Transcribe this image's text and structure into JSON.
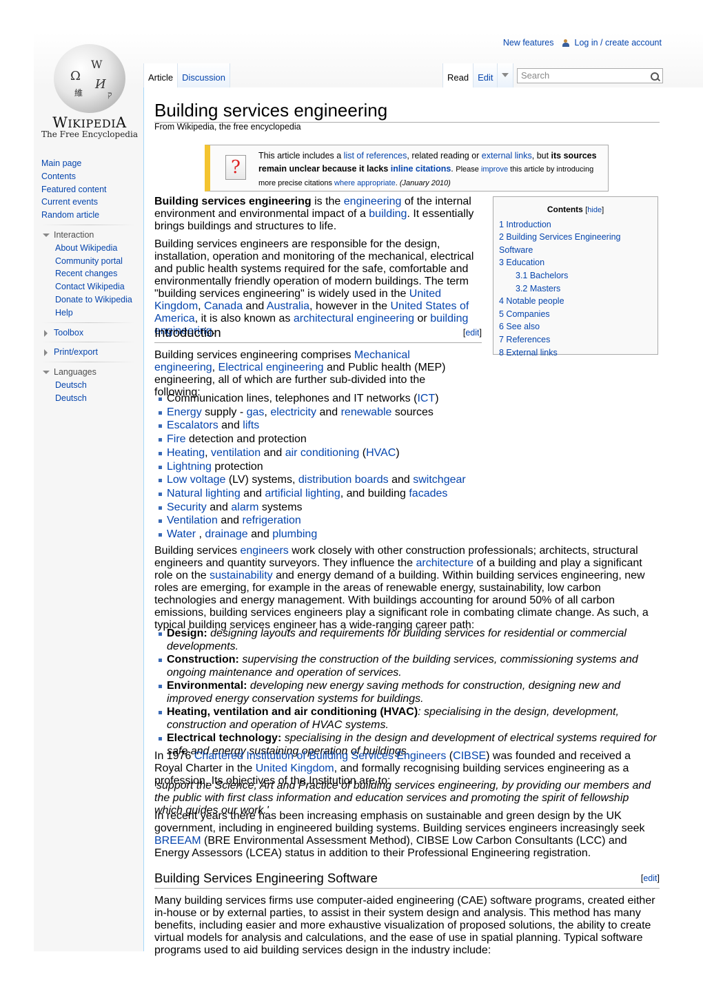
{
  "personal": {
    "new_features": "New features",
    "login": "Log in / create account"
  },
  "logo": {
    "wordmark_main": "Wikipedia",
    "tagline": "The Free Encyclopedia"
  },
  "tabs": {
    "article": "Article",
    "discussion": "Discussion",
    "read": "Read",
    "edit": "Edit"
  },
  "search": {
    "placeholder": "Search"
  },
  "sidebar": {
    "nav": [
      "Main page",
      "Contents",
      "Featured content",
      "Current events",
      "Random article"
    ],
    "interaction": {
      "title": "Interaction",
      "items": [
        "About Wikipedia",
        "Community portal",
        "Recent changes",
        "Contact Wikipedia",
        "Donate to Wikipedia",
        "Help"
      ]
    },
    "toolbox": "Toolbox",
    "print_export": "Print/export",
    "languages": {
      "title": "Languages",
      "items": [
        "Deutsch",
        "Deutsch"
      ]
    }
  },
  "article": {
    "title": "Building services engineering",
    "subtitle": "From Wikipedia, the free encyclopedia",
    "ambox": {
      "t1": "This article includes a ",
      "l1": "list of references",
      "t2": ", related reading or ",
      "l2": "external links",
      "t3": ", but ",
      "b1": "its sources remain unclear because it lacks ",
      "l3": "inline citations",
      "t4": ". ",
      "t5": "Please ",
      "l4": "improve",
      "t6": " this article by introducing more precise citations ",
      "l5": "where appropriate",
      "t7": ". ",
      "date": "(January 2010)"
    },
    "toc": {
      "title": "Contents",
      "hide": "hide",
      "items": [
        {
          "label": "1 Introduction",
          "sub": false
        },
        {
          "label": "2 Building Services Engineering Software",
          "sub": false
        },
        {
          "label": "3 Education",
          "sub": false
        },
        {
          "label": "3.1 Bachelors",
          "sub": true
        },
        {
          "label": "3.2 Masters",
          "sub": true
        },
        {
          "label": "4 Notable people",
          "sub": false
        },
        {
          "label": "5 Companies",
          "sub": false
        },
        {
          "label": "6 See also",
          "sub": false
        },
        {
          "label": "7 References",
          "sub": false
        },
        {
          "label": "8 External links",
          "sub": false
        }
      ]
    },
    "lead1": {
      "b": "Building services engineering",
      "t1": " is the ",
      "l1": "engineering",
      "t2": " of the internal environment and environmental impact of a ",
      "l2": "building",
      "t3": ". It essentially brings buildings and structures to life."
    },
    "lead2": {
      "t1": "Building services engineers are responsible for the design, installation, operation and monitoring of the mechanical, electrical and public health systems required for the safe, comfortable and environmentally friendly operation of modern buildings. The term \"building services engineering\" is widely used in the ",
      "l1": "United Kingdom",
      "t2": ", ",
      "l2": "Canada",
      "t3": " and ",
      "l3": "Australia",
      "t4": ", however in the ",
      "l4": "United States of America",
      "t5": ", it is also known as ",
      "l5": "architectural engineering",
      "t6": " or ",
      "l6": "building engineering",
      "t7": "."
    },
    "intro_heading": "Introduction",
    "edit_label": "edit",
    "intro_p": {
      "t1": "Building services engineering comprises ",
      "l1": "Mechanical engineering",
      "t2": ", ",
      "l2": "Electrical engineering",
      "t3": " and Public health (MEP) engineering, all of which are further sub-divided into the following:"
    },
    "systems_list": [
      [
        {
          "t": "Communication lines, telephones and IT networks ("
        },
        {
          "l": "ICT"
        },
        {
          "t": ")"
        }
      ],
      [
        {
          "l": "Energy"
        },
        {
          "t": " supply - "
        },
        {
          "l": "gas"
        },
        {
          "t": ", "
        },
        {
          "l": "electricity"
        },
        {
          "t": " and "
        },
        {
          "l": "renewable"
        },
        {
          "t": " sources"
        }
      ],
      [
        {
          "l": "Escalators"
        },
        {
          "t": " and "
        },
        {
          "l": "lifts"
        }
      ],
      [
        {
          "l": "Fire"
        },
        {
          "t": " detection and protection"
        }
      ],
      [
        {
          "l": "Heating"
        },
        {
          "t": ", "
        },
        {
          "l": "ventilation"
        },
        {
          "t": " and "
        },
        {
          "l": "air conditioning"
        },
        {
          "t": " ("
        },
        {
          "l": "HVAC"
        },
        {
          "t": ")"
        }
      ],
      [
        {
          "l": "Lightning"
        },
        {
          "t": " protection"
        }
      ],
      [
        {
          "l": "Low voltage"
        },
        {
          "t": " (LV) systems, "
        },
        {
          "l": "distribution boards"
        },
        {
          "t": " and "
        },
        {
          "l": "switchgear"
        }
      ],
      [
        {
          "l": "Natural lighting"
        },
        {
          "t": " and "
        },
        {
          "l": "artificial lighting"
        },
        {
          "t": ", and building "
        },
        {
          "l": "facades"
        }
      ],
      [
        {
          "l": "Security"
        },
        {
          "t": " and "
        },
        {
          "l": "alarm"
        },
        {
          "t": " systems"
        }
      ],
      [
        {
          "l": "Ventilation"
        },
        {
          "t": " and "
        },
        {
          "l": "refrigeration"
        }
      ],
      [
        {
          "l": "Water"
        },
        {
          "t": " , "
        },
        {
          "l": "drainage"
        },
        {
          "t": " and "
        },
        {
          "l": "plumbing"
        }
      ]
    ],
    "para3": {
      "t1": "Building services ",
      "l1": "engineers",
      "t2": " work closely with other construction professionals; architects, structural engineers and quantity surveyors. They influence the ",
      "l2": "architecture",
      "t3": " of a building and play a significant role on the ",
      "l3": "sustainability",
      "t4": " and energy demand of a building. Within building services engineering, new roles are emerging, for example in the areas of renewable energy, sustainability, low carbon technologies and energy management. With buildings accounting for around 50% of all carbon emissions, building services engineers play a significant role in combating climate change. As such, a typical building services engineer has a wide-ranging career path:"
    },
    "career_list": [
      {
        "b": "Design:",
        "i": " designing layouts and requirements for building services for residential or commercial developments."
      },
      {
        "b": "Construction:",
        "i": " supervising the construction of the building services, commissioning systems and ongoing maintenance and operation of services."
      },
      {
        "b": "Environmental:",
        "i": " developing new energy saving methods for construction, designing new and improved energy conservation systems for buildings."
      },
      {
        "b": "Heating, ventilation and air conditioning (HVAC)",
        "i": ": specialising in the design, development, construction and operation of HVAC systems."
      },
      {
        "b": "Electrical technology:",
        "i": " specialising in the design and development of electrical systems required for safe and energy sustaining operation of buildings."
      }
    ],
    "para4": {
      "t1": "In 1976 ",
      "l1": "Chartered Institution of Building Services Engineers",
      "t2": " (",
      "l2": "CIBSE",
      "t3": ") was founded and received a Royal Charter in the ",
      "l3": "United Kingdom",
      "t4": ", and formally recognising building services engineering as a profession. Its objectives of the Institution are to:"
    },
    "quote": "'support the Science, Art and Practice of building services engineering, by providing our members and the public with first class information and education services and promoting the spirit of fellowship which guides our work.'",
    "para5": {
      "t1": "In recent years there has been increasing emphasis on sustainable and green design by the UK government, including in engineered building systems. Building services engineers increasingly seek ",
      "l1": "BREEAM",
      "t2": " (BRE Environmental Assessment Method), CIBSE Low Carbon Consultants (LCC) and Energy Assessors (LCEA) status in addition to their Professional Engineering registration."
    },
    "software_heading": "Building Services Engineering Software",
    "software_p": "Many building services firms use computer-aided engineering (CAE) software programs, created either in-house or by external parties, to assist in their system design and analysis. This method has many benefits, including easier and more exhaustive visualization of proposed solutions, the ability to create virtual models for analysis and calculations, and the ease of use in spatial planning. Typical software programs used to aid building services design in the industry include:"
  },
  "colors": {
    "link": "#0645ad",
    "tab_border": "#a7d7f9",
    "ambox_accent": "#f4c430",
    "sidebar_bg": "#f6f6f6"
  }
}
